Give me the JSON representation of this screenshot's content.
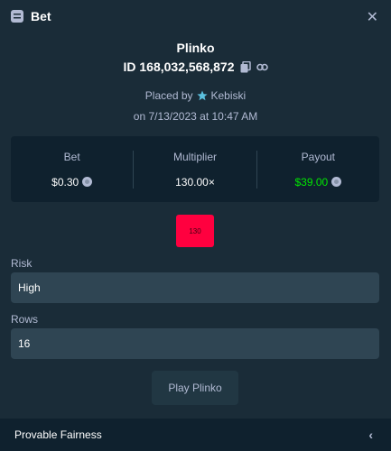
{
  "header": {
    "title": "Bet",
    "close_icon": "close-icon"
  },
  "bet": {
    "game": "Plinko",
    "id": "ID 168,032,568,872",
    "placed_by_prefix": "Placed by",
    "user": "Kebiski",
    "date": "on 7/13/2023 at 10:47 AM"
  },
  "stats": {
    "bet_label": "Bet",
    "bet_value": "$0.30",
    "multiplier_label": "Multiplier",
    "multiplier_value": "130.00×",
    "payout_label": "Payout",
    "payout_value": "$39.00"
  },
  "result_chip": "130",
  "risk": {
    "label": "Risk",
    "value": "High"
  },
  "rows": {
    "label": "Rows",
    "value": "16"
  },
  "play_button": "Play Plinko",
  "footer": {
    "label": "Provable Fairness"
  },
  "colors": {
    "background": "#1a2c38",
    "panel": "#0f212e",
    "field": "#2f4553",
    "payout_green": "#00e701",
    "chip_red": "#ff003f"
  }
}
